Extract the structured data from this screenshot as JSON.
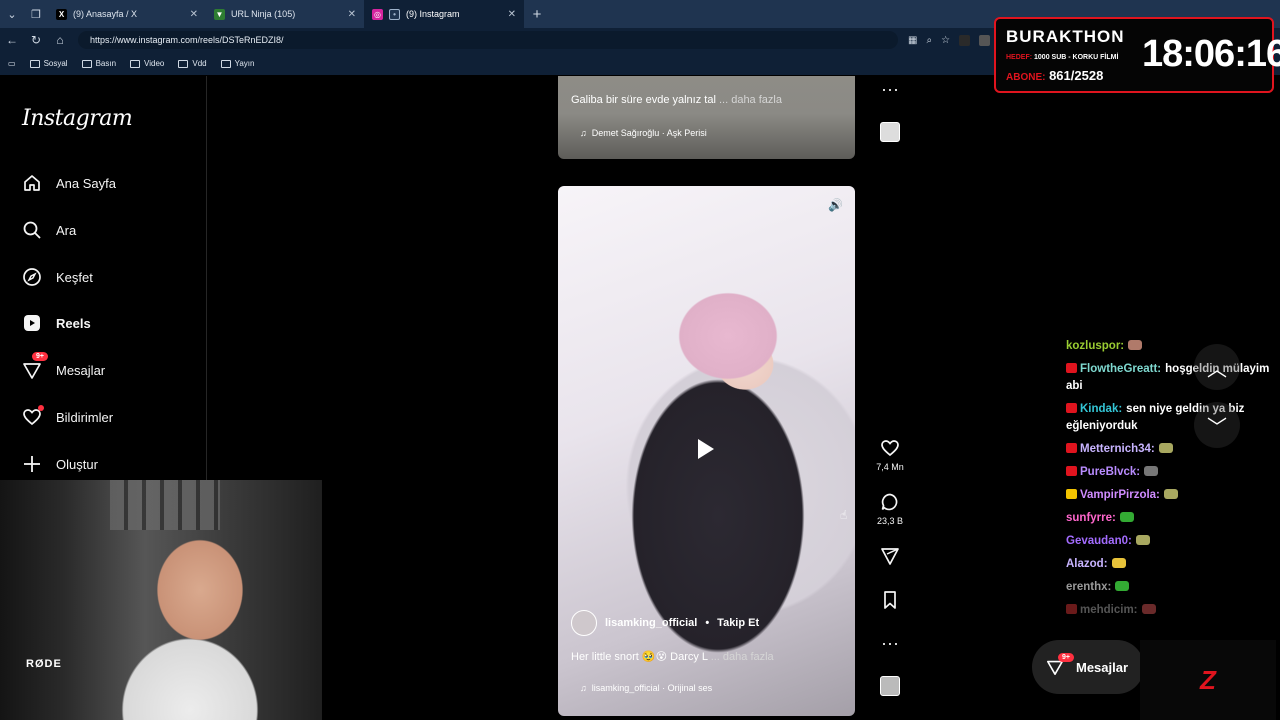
{
  "browser": {
    "tabs": [
      {
        "title": "(9) Anasayfa / X",
        "icon": "x-logo-icon",
        "active": false
      },
      {
        "title": "URL Ninja (105)",
        "icon": "url-ninja-icon",
        "active": false
      },
      {
        "title": "(9) Instagram",
        "icon": "instagram-icon",
        "active": true
      }
    ],
    "new_tab": "+",
    "url": "https://www.instagram.com/reels/DSTeRnEDZI8/",
    "bookmarks": [
      "Sosyal",
      "Basın",
      "Video",
      "Vdd",
      "Yayın"
    ]
  },
  "instagram": {
    "logo": "Instagram",
    "nav": [
      {
        "label": "Ana Sayfa",
        "icon": "home-icon"
      },
      {
        "label": "Ara",
        "icon": "search-icon"
      },
      {
        "label": "Keşfet",
        "icon": "compass-icon"
      },
      {
        "label": "Reels",
        "icon": "reels-icon",
        "active": true
      },
      {
        "label": "Mesajlar",
        "icon": "messenger-icon",
        "badge": "9+"
      },
      {
        "label": "Bildirimler",
        "icon": "heart-icon"
      },
      {
        "label": "Oluştur",
        "icon": "plus-icon"
      }
    ],
    "prev_reel": {
      "caption": "Galiba bir süre evde yalnız tal",
      "more": "... daha fazla",
      "audio": "Demet Sağıroğlu · Aşk Perisi"
    },
    "reel": {
      "username": "lisamking_official",
      "separator": "•",
      "follow": "Takip Et",
      "caption": "Her little snort 🥹😵 Darcy L",
      "more": "... daha fazla",
      "audio": "lisamking_official · Orijinal ses"
    },
    "actions": {
      "likes": "7,4 Mn",
      "comments": "23,3 B"
    },
    "messages_pill": {
      "label": "Mesajlar",
      "badge": "9+"
    }
  },
  "stream": {
    "brand": "BURAKTHON",
    "goal_label": "HEDEF:",
    "goal_text": "1000 SUB - KORKU FİLMİ",
    "subs_label": "ABONE:",
    "subs_value": "861/2528",
    "timer": "18:06:16",
    "mic_label": "RØDE",
    "logo_text": "Z",
    "chat": [
      {
        "user": "kozluspor:",
        "text": "",
        "color": "#9acd32",
        "chip": "",
        "emote": "#b07a6a"
      },
      {
        "user": "FlowtheGreatt:",
        "text": "hoşgeldin mülayim abi",
        "color": "#7fd9d0",
        "chip": "#e0141e",
        "emote": ""
      },
      {
        "user": "Kindak:",
        "text": "sen niye geldin ya biz eğleniyorduk",
        "color": "#34c6d6",
        "chip": "#e0141e",
        "emote": ""
      },
      {
        "user": "Metternich34:",
        "text": "",
        "color": "#c8b4ff",
        "chip": "#e0141e",
        "emote": "#a8a860"
      },
      {
        "user": "PureBlvck:",
        "text": "",
        "color": "#b98cff",
        "chip": "#e0141e",
        "emote": "#777777"
      },
      {
        "user": "VampirPirzola:",
        "text": "",
        "color": "#d08cff",
        "chip": "#f3c400",
        "emote": "#a8a860"
      },
      {
        "user": "sunfyrre:",
        "text": "",
        "color": "#ff66cc",
        "chip": "",
        "emote": "#33aa33"
      },
      {
        "user": "Gevaudan0:",
        "text": "",
        "color": "#a36cff",
        "chip": "",
        "emote": "#a8a860"
      },
      {
        "user": "Alazod:",
        "text": "",
        "color": "#c8b4ff",
        "chip": "",
        "emote": "#e8c33a"
      },
      {
        "user": "erenthx:",
        "text": "",
        "color": "#999999",
        "chip": "",
        "emote": "#33aa33"
      },
      {
        "user": "mehdicim:",
        "text": "",
        "color": "#555555",
        "chip": "#6a1a1a",
        "emote": "#6a2a2a"
      }
    ]
  }
}
